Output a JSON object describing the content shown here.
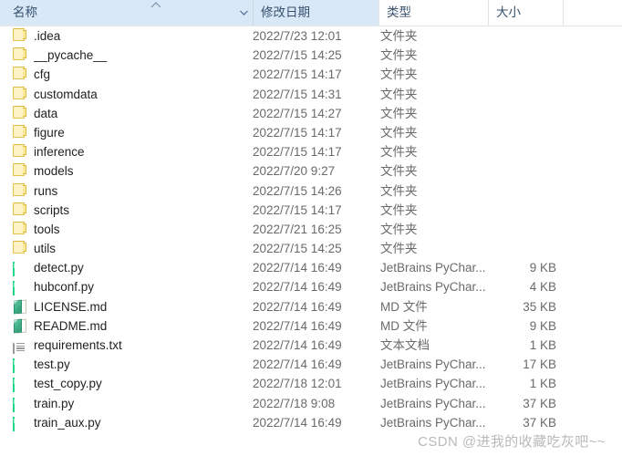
{
  "header": {
    "columns": [
      {
        "label": "名称",
        "key": "name"
      },
      {
        "label": "修改日期",
        "key": "date"
      },
      {
        "label": "类型",
        "key": "type"
      },
      {
        "label": "大小",
        "key": "size"
      }
    ],
    "sort": {
      "column": "名称",
      "direction": "ascending",
      "indicator": "caret-up"
    },
    "dropdown_icon": "chevron-down-icon"
  },
  "rows": [
    {
      "icon": "folder-icon",
      "name": ".idea",
      "date": "2022/7/23 12:01",
      "type": "文件夹",
      "size": ""
    },
    {
      "icon": "folder-icon",
      "name": "__pycache__",
      "date": "2022/7/15 14:25",
      "type": "文件夹",
      "size": ""
    },
    {
      "icon": "folder-icon",
      "name": "cfg",
      "date": "2022/7/15 14:17",
      "type": "文件夹",
      "size": ""
    },
    {
      "icon": "folder-icon",
      "name": "customdata",
      "date": "2022/7/15 14:31",
      "type": "文件夹",
      "size": ""
    },
    {
      "icon": "folder-icon",
      "name": "data",
      "date": "2022/7/15 14:27",
      "type": "文件夹",
      "size": ""
    },
    {
      "icon": "folder-icon",
      "name": "figure",
      "date": "2022/7/15 14:17",
      "type": "文件夹",
      "size": ""
    },
    {
      "icon": "folder-icon",
      "name": "inference",
      "date": "2022/7/15 14:17",
      "type": "文件夹",
      "size": ""
    },
    {
      "icon": "folder-icon",
      "name": "models",
      "date": "2022/7/20 9:27",
      "type": "文件夹",
      "size": ""
    },
    {
      "icon": "folder-icon",
      "name": "runs",
      "date": "2022/7/15 14:26",
      "type": "文件夹",
      "size": ""
    },
    {
      "icon": "folder-icon",
      "name": "scripts",
      "date": "2022/7/15 14:17",
      "type": "文件夹",
      "size": ""
    },
    {
      "icon": "folder-icon",
      "name": "tools",
      "date": "2022/7/21 16:25",
      "type": "文件夹",
      "size": ""
    },
    {
      "icon": "folder-icon",
      "name": "utils",
      "date": "2022/7/15 14:25",
      "type": "文件夹",
      "size": ""
    },
    {
      "icon": "pycharm-icon",
      "name": "detect.py",
      "date": "2022/7/14 16:49",
      "type": "JetBrains PyChar...",
      "size": "9 KB"
    },
    {
      "icon": "pycharm-icon",
      "name": "hubconf.py",
      "date": "2022/7/14 16:49",
      "type": "JetBrains PyChar...",
      "size": "4 KB"
    },
    {
      "icon": "markdown-icon",
      "name": "LICENSE.md",
      "date": "2022/7/14 16:49",
      "type": "MD 文件",
      "size": "35 KB"
    },
    {
      "icon": "markdown-icon",
      "name": "README.md",
      "date": "2022/7/14 16:49",
      "type": "MD 文件",
      "size": "9 KB"
    },
    {
      "icon": "textfile-icon",
      "name": "requirements.txt",
      "date": "2022/7/14 16:49",
      "type": "文本文档",
      "size": "1 KB"
    },
    {
      "icon": "pycharm-icon",
      "name": "test.py",
      "date": "2022/7/14 16:49",
      "type": "JetBrains PyChar...",
      "size": "17 KB"
    },
    {
      "icon": "pycharm-icon",
      "name": "test_copy.py",
      "date": "2022/7/18 12:01",
      "type": "JetBrains PyChar...",
      "size": "1 KB"
    },
    {
      "icon": "pycharm-icon",
      "name": "train.py",
      "date": "2022/7/18 9:08",
      "type": "JetBrains PyChar...",
      "size": "37 KB"
    },
    {
      "icon": "pycharm-icon",
      "name": "train_aux.py",
      "date": "2022/7/14 16:49",
      "type": "JetBrains PyChar...",
      "size": "37 KB"
    }
  ],
  "watermark": {
    "text": "CSDN @进我的收藏吃灰吧~~"
  },
  "colors": {
    "header_highlight": "#d9e8f7",
    "header_text": "#37506e",
    "row_text": "#222222",
    "meta_text": "#6a6a6a",
    "folder_fill": "#fdf3c6",
    "pycharm_accent": "#21d789",
    "markdown_accent": "#3fae86",
    "watermark": "#b9b9b9"
  }
}
